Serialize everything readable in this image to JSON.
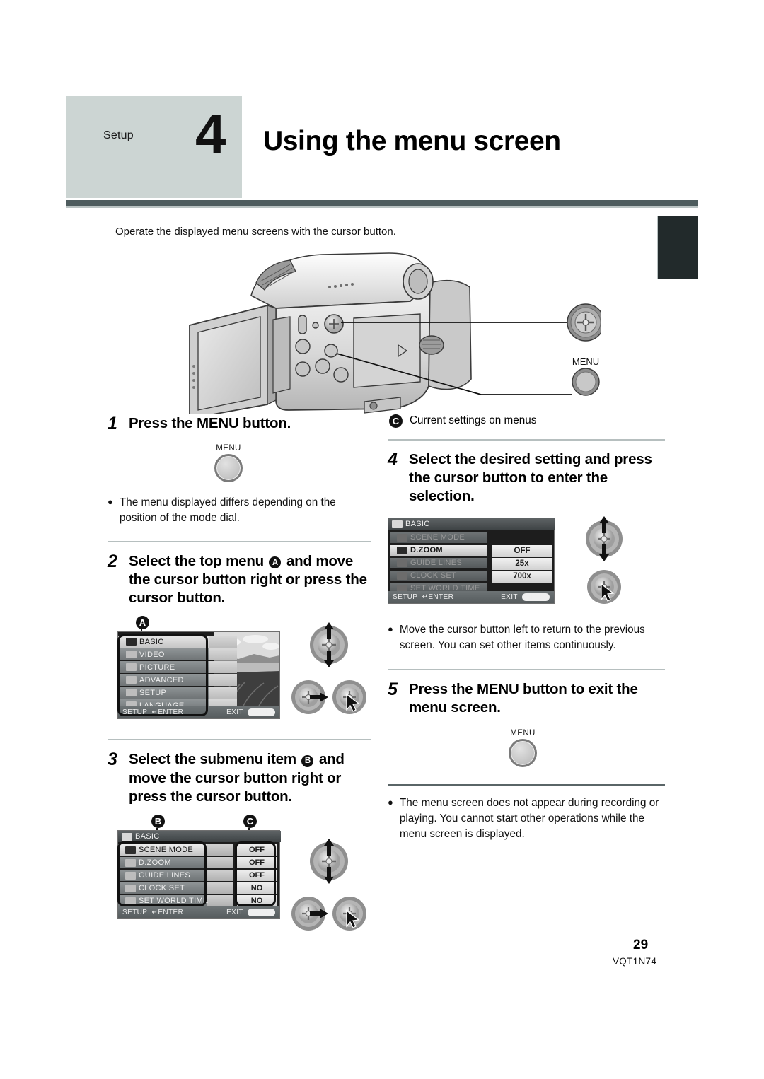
{
  "header": {
    "section_label": "Setup",
    "chapter_number": "4",
    "title": "Using the menu screen",
    "block_color": "#ccd5d3",
    "rule_color": "#4e5c5e"
  },
  "intro": "Operate the displayed menu screens with the cursor button.",
  "illustration": {
    "cursor_button_label": "",
    "menu_button_label": "MENU"
  },
  "steps": {
    "step1": {
      "number": "1",
      "text": "Press the MENU button.",
      "button_label": "MENU",
      "note": "The menu displayed differs depending on the position of the mode dial."
    },
    "step2": {
      "number": "2",
      "text_part1": "Select the top menu",
      "badge": "A",
      "text_part2": "and move the cursor button right or press the cursor button."
    },
    "step3": {
      "number": "3",
      "text_part1": "Select the submenu item",
      "badge": "B",
      "text_part2": "and move the cursor button right or press the cursor button."
    },
    "step4": {
      "number": "4",
      "text": "Select the desired setting and press the cursor button to enter the selection.",
      "note": "Move the cursor button left to return to the previous screen. You can set other items continuously."
    },
    "step5": {
      "number": "5",
      "text": "Press the MENU button to exit the menu screen.",
      "button_label": "MENU",
      "note": "The menu screen does not appear during recording or playing. You cannot start other operations while the menu screen is displayed."
    }
  },
  "callout_c": {
    "badge": "C",
    "text": "Current settings on menus"
  },
  "screens": {
    "top_menu": {
      "badge": "A",
      "items": [
        {
          "label": "BASIC",
          "icon": "wrench-icon",
          "selected": true
        },
        {
          "label": "VIDEO",
          "icon": "camcorder-icon",
          "selected": false
        },
        {
          "label": "PICTURE",
          "icon": "camera-icon",
          "selected": false
        },
        {
          "label": "ADVANCED",
          "icon": "movie-camera-icon",
          "selected": false
        },
        {
          "label": "SETUP",
          "icon": "tools-icon",
          "selected": false
        },
        {
          "label": "LANGUAGE",
          "icon": "globe-icon",
          "selected": false
        }
      ],
      "bottom_left": "SETUP",
      "bottom_enter": "ENTER",
      "bottom_exit": "EXIT",
      "bottom_exit_pill": "MENU"
    },
    "submenu": {
      "badge_items": "B",
      "badge_values": "C",
      "title": "BASIC",
      "title_icon": "wrench-icon",
      "rows": [
        {
          "label": "SCENE MODE",
          "icon": "scene-mode-icon",
          "value": "OFF",
          "selected": true
        },
        {
          "label": "D.ZOOM",
          "icon": "zoom-icon",
          "value": "OFF",
          "selected": false
        },
        {
          "label": "GUIDE LINES",
          "icon": "grid-icon",
          "value": "OFF",
          "selected": false
        },
        {
          "label": "CLOCK SET",
          "icon": "clock-icon",
          "value": "NO",
          "selected": false
        },
        {
          "label": "SET WORLD TIME",
          "icon": "globe-icon",
          "value": "NO",
          "selected": false
        }
      ],
      "bottom_left": "SETUP",
      "bottom_enter": "ENTER",
      "bottom_exit": "EXIT",
      "bottom_exit_pill": "MENU"
    },
    "dzoom_options": {
      "title": "BASIC",
      "title_icon": "wrench-icon",
      "rows": [
        {
          "label": "SCENE MODE",
          "icon": "scene-mode-icon",
          "selected": false
        },
        {
          "label": "D.ZOOM",
          "icon": "zoom-icon",
          "selected": true
        },
        {
          "label": "GUIDE LINES",
          "icon": "grid-icon",
          "selected": false
        },
        {
          "label": "CLOCK SET",
          "icon": "clock-icon",
          "selected": false
        },
        {
          "label": "SET WORLD TIME",
          "icon": "globe-icon",
          "selected": false
        }
      ],
      "options": [
        {
          "label": "OFF",
          "selected": true
        },
        {
          "label": "25x",
          "selected": false
        },
        {
          "label": "700x",
          "selected": false
        }
      ],
      "bottom_left": "SETUP",
      "bottom_enter": "ENTER",
      "bottom_exit": "EXIT",
      "bottom_exit_pill": "MENU"
    }
  },
  "footer": {
    "page_number": "29",
    "document_code": "VQT1N74"
  }
}
